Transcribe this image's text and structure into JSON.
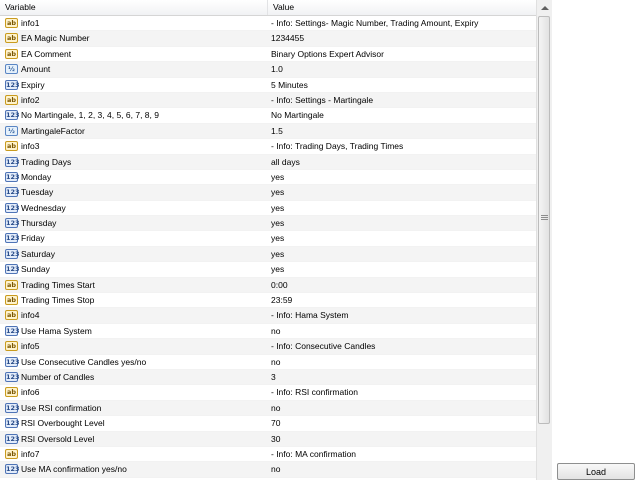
{
  "header": {
    "variable": "Variable",
    "value": "Value"
  },
  "rows": [
    {
      "type": "ab",
      "name": "info1",
      "value": "- Info: Settings- Magic Number, Trading Amount, Expiry"
    },
    {
      "type": "ab",
      "name": "EA Magic Number",
      "value": "1234455"
    },
    {
      "type": "ab",
      "name": "EA Comment",
      "value": "Binary Options Expert Advisor"
    },
    {
      "type": "dbl",
      "name": "Amount",
      "value": "1.0"
    },
    {
      "type": "int",
      "name": "Expiry",
      "value": "5 Minutes"
    },
    {
      "type": "ab",
      "name": "info2",
      "value": "- Info: Settings - Martingale"
    },
    {
      "type": "int",
      "name": "No Martingale, 1, 2, 3, 4, 5, 6, 7, 8, 9",
      "value": "No Martingale"
    },
    {
      "type": "dbl",
      "name": "MartingaleFactor",
      "value": "1.5"
    },
    {
      "type": "ab",
      "name": "info3",
      "value": "- Info: Trading Days, Trading Times"
    },
    {
      "type": "int",
      "name": "Trading Days",
      "value": "all days"
    },
    {
      "type": "int",
      "name": "Monday",
      "value": "yes"
    },
    {
      "type": "int",
      "name": "Tuesday",
      "value": "yes"
    },
    {
      "type": "int",
      "name": "Wednesday",
      "value": "yes"
    },
    {
      "type": "int",
      "name": "Thursday",
      "value": "yes"
    },
    {
      "type": "int",
      "name": "Friday",
      "value": "yes"
    },
    {
      "type": "int",
      "name": "Saturday",
      "value": "yes"
    },
    {
      "type": "int",
      "name": "Sunday",
      "value": "yes"
    },
    {
      "type": "ab",
      "name": "Trading Times Start",
      "value": "0:00"
    },
    {
      "type": "ab",
      "name": "Trading Times Stop",
      "value": "23:59"
    },
    {
      "type": "ab",
      "name": "info4",
      "value": "- Info: Hama System"
    },
    {
      "type": "int",
      "name": "Use Hama System",
      "value": "no"
    },
    {
      "type": "ab",
      "name": "info5",
      "value": "- Info: Consecutive Candles"
    },
    {
      "type": "int",
      "name": "Use Consecutive Candles yes/no",
      "value": "no"
    },
    {
      "type": "int",
      "name": "Number of Candles",
      "value": "3"
    },
    {
      "type": "ab",
      "name": "info6",
      "value": "- Info: RSI confirmation"
    },
    {
      "type": "int",
      "name": "Use RSI confirmation",
      "value": "no"
    },
    {
      "type": "int",
      "name": "RSI Overbought Level",
      "value": "70"
    },
    {
      "type": "int",
      "name": "RSI Oversold Level",
      "value": "30"
    },
    {
      "type": "ab",
      "name": "info7",
      "value": "- Info: MA confirmation"
    },
    {
      "type": "int",
      "name": "Use MA confirmation yes/no",
      "value": "no"
    }
  ],
  "icons": {
    "ab": "ab",
    "int": "123",
    "dbl": "½"
  },
  "buttons": {
    "load": "Load"
  }
}
